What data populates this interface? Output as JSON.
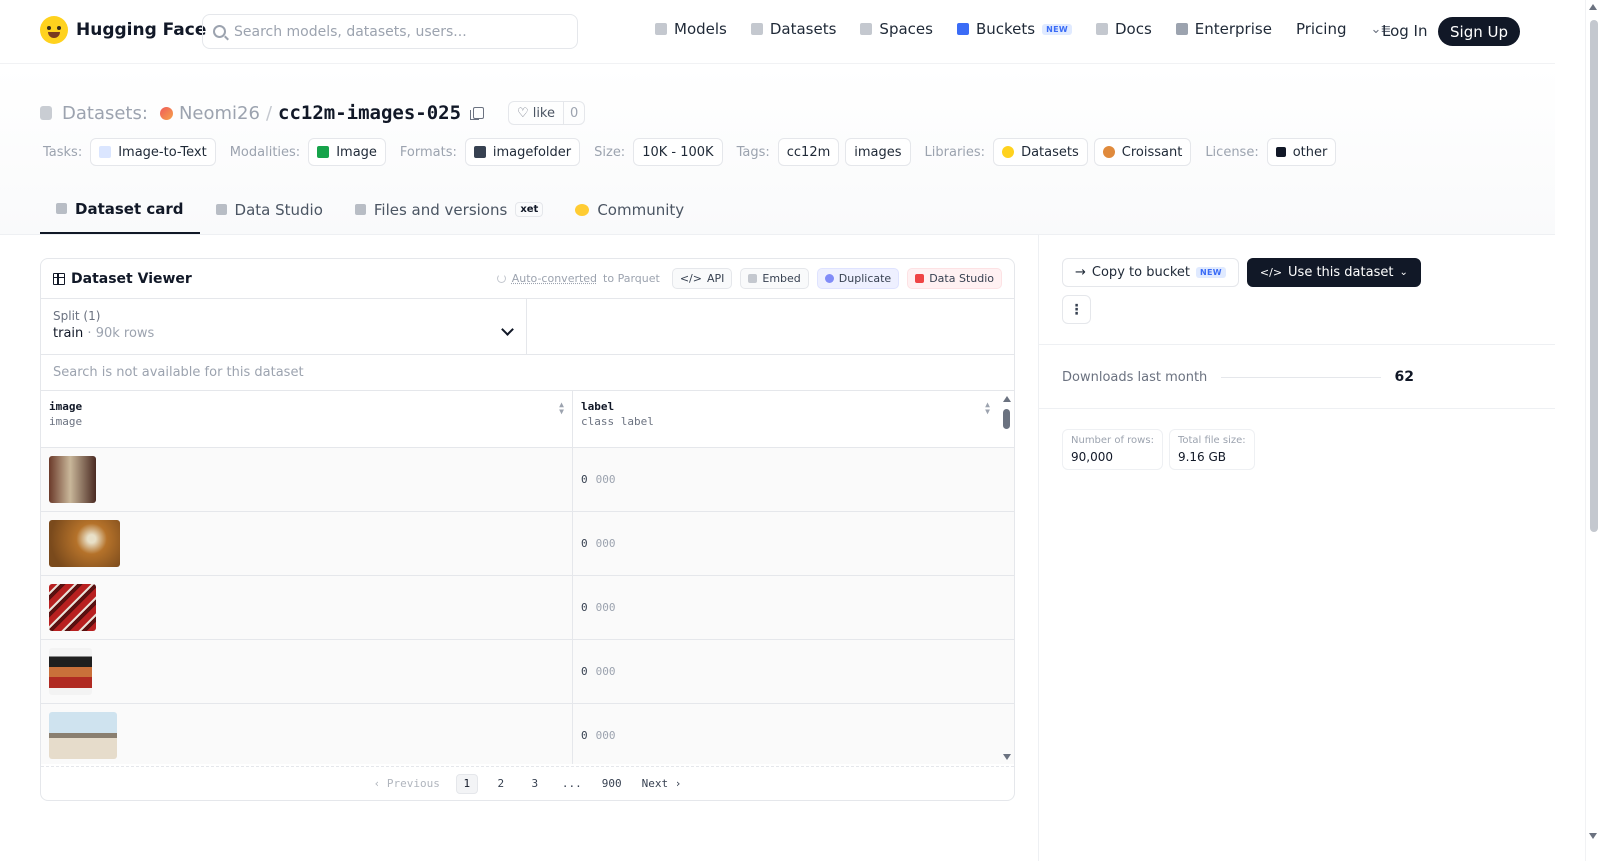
{
  "nav": {
    "brand": "Hugging Face",
    "search_placeholder": "Search models, datasets, users...",
    "links": {
      "models": "Models",
      "datasets": "Datasets",
      "spaces": "Spaces",
      "buckets": "Buckets",
      "buckets_badge": "NEW",
      "docs": "Docs",
      "enterprise": "Enterprise",
      "pricing": "Pricing"
    },
    "login": "Log In",
    "signup": "Sign Up"
  },
  "header": {
    "crumb_label": "Datasets:",
    "owner": "Neomi26",
    "separator": "/",
    "repo": "cc12m-images-025",
    "like_label": "like",
    "like_count": "0",
    "tags": {
      "tasks_label": "Tasks:",
      "task": "Image-to-Text",
      "modalities_label": "Modalities:",
      "modality": "Image",
      "formats_label": "Formats:",
      "format": "imagefolder",
      "size_label": "Size:",
      "size": "10K - 100K",
      "tags_label": "Tags:",
      "tag1": "cc12m",
      "tag2": "images",
      "libraries_label": "Libraries:",
      "library1": "Datasets",
      "library2": "Croissant",
      "license_label": "License:",
      "license": "other"
    }
  },
  "tabs": {
    "card": "Dataset card",
    "studio": "Data Studio",
    "files": "Files and versions",
    "files_badge": "xet",
    "community": "Community"
  },
  "viewer": {
    "title": "Dataset Viewer",
    "autoconv_link": "Auto-converted",
    "autoconv_rest": "to Parquet",
    "api": "API",
    "embed": "Embed",
    "duplicate": "Duplicate",
    "studio": "Data Studio",
    "split_label": "Split (1)",
    "split_name": "train",
    "split_dot": "·",
    "split_rows": "90k rows",
    "search_unavailable": "Search is not available for this dataset",
    "columns": [
      {
        "name": "image",
        "type": "image"
      },
      {
        "name": "label",
        "type": "class label"
      }
    ],
    "rows": [
      {
        "label_id": "0",
        "label_name": "000"
      },
      {
        "label_id": "0",
        "label_name": "000"
      },
      {
        "label_id": "0",
        "label_name": "000"
      },
      {
        "label_id": "0",
        "label_name": "000"
      },
      {
        "label_id": "0",
        "label_name": "000"
      }
    ],
    "pager": {
      "previous": "Previous",
      "pages": [
        "1",
        "2",
        "3",
        "...",
        "900"
      ],
      "next": "Next"
    }
  },
  "side": {
    "copy_bucket": "Copy to bucket",
    "copy_badge": "NEW",
    "use_dataset": "Use this dataset",
    "more": "⋮",
    "downloads_label": "Downloads last month",
    "downloads_value": "62",
    "rows_label": "Number of rows:",
    "rows_value": "90,000",
    "size_label": "Total file size:",
    "size_value": "9.16 GB"
  }
}
